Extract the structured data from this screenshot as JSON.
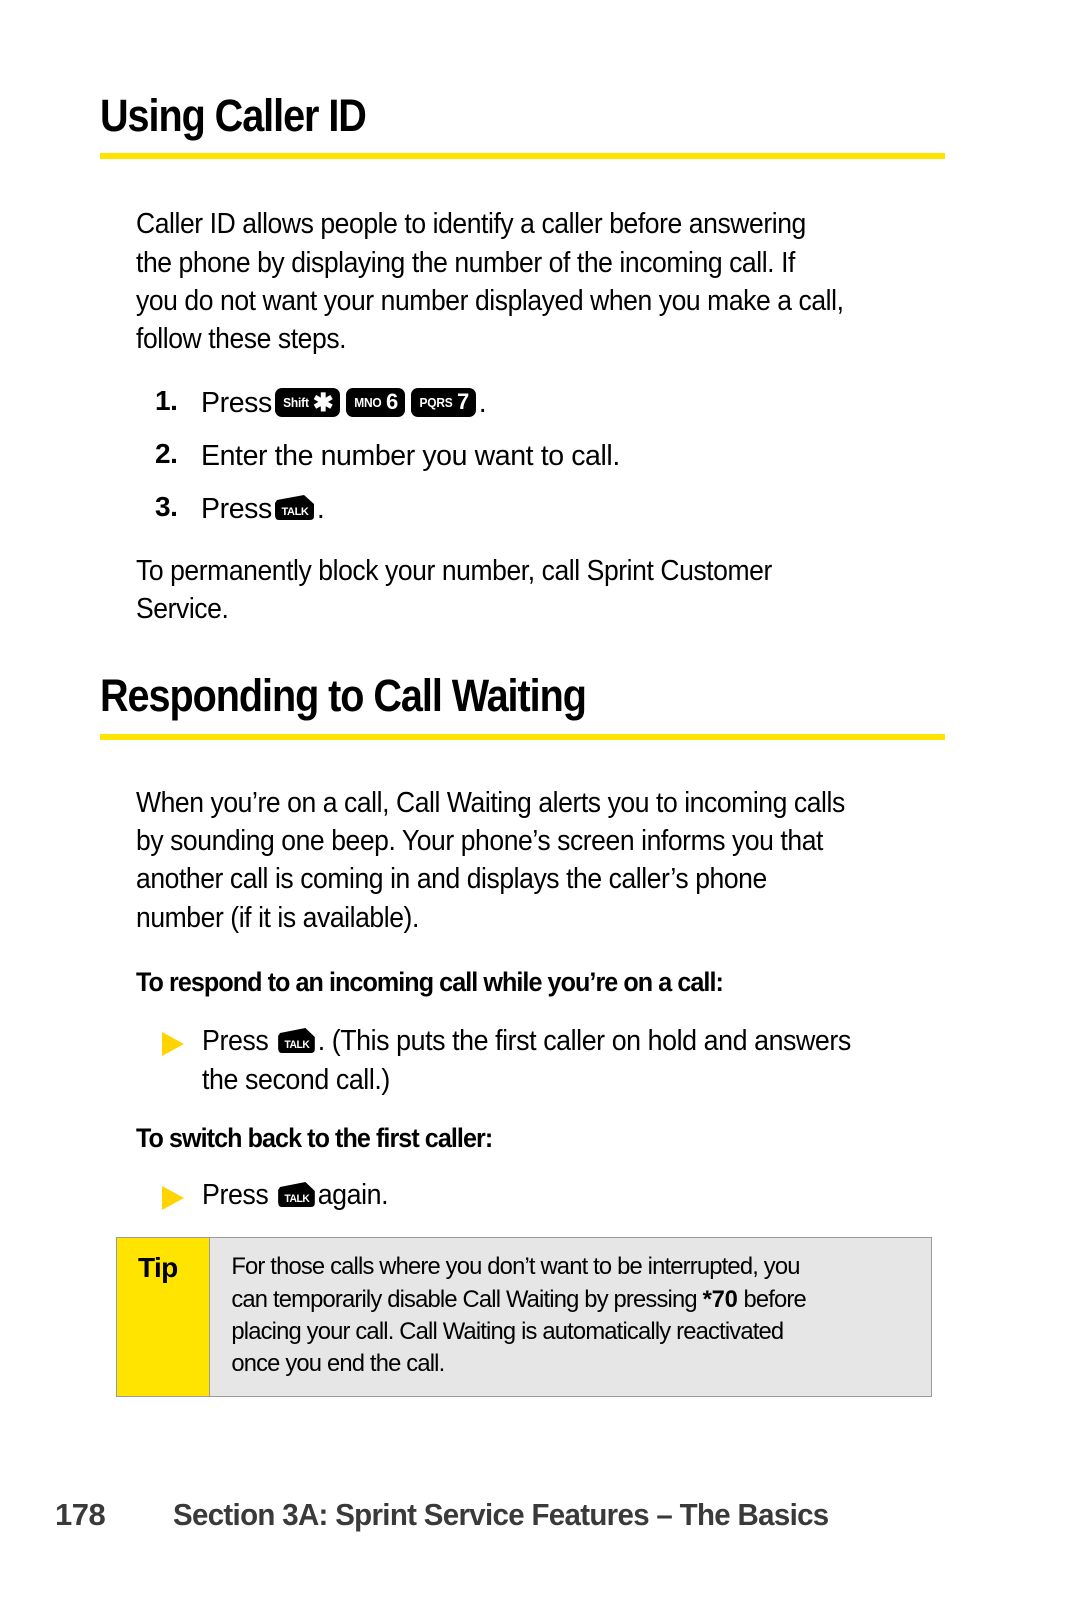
{
  "page": {
    "folio": "178",
    "footer_title": "Section 3A: Sprint Service Features – The Basics",
    "accent_yellow": "#FFE400",
    "tip_background": "#E6E6E6",
    "text_color": "#000000"
  },
  "section1": {
    "heading": "Using Caller ID",
    "intro_lines": [
      "Caller ID allows people to identify a caller before answering",
      "the phone by displaying the number of the incoming call. If",
      "you do not want your number displayed when you make a call,",
      "follow these steps."
    ],
    "steps": [
      {
        "number": "1.",
        "text_before": "Press",
        "keys": [
          {
            "label": "Shift",
            "glyph": "✱",
            "icon": "key-star-icon"
          },
          {
            "label": "MNO",
            "glyph": "6",
            "icon": "key-six-icon"
          },
          {
            "label": "PQRS",
            "glyph": "7",
            "icon": "key-seven-icon"
          }
        ],
        "text_after": "."
      },
      {
        "number": "2.",
        "text_before": "Enter the number you want to call.",
        "keys": [],
        "text_after": ""
      },
      {
        "number": "3.",
        "text_before": "Press",
        "keys": [
          {
            "label": "TALK",
            "glyph": "",
            "icon": "key-talk-icon"
          }
        ],
        "text_after": "."
      }
    ],
    "closing_lines": [
      "To permanently block your number, call Sprint Customer",
      "Service."
    ]
  },
  "section2": {
    "heading": "Responding to Call Waiting",
    "intro_lines": [
      "When you’re on a call, Call Waiting alerts you to incoming calls",
      "by sounding one beep. Your phone’s screen informs you that",
      "another call is coming in and displays the caller’s phone",
      "number (if it is available)."
    ],
    "subhead1": "To respond to an incoming call while you’re on a call:",
    "bullet1": {
      "text_before": "Press",
      "key": {
        "label": "TALK",
        "icon": "key-talk-icon"
      },
      "text_after_line1": ". (This puts the first caller on hold and answers",
      "text_after_line2": "the second call.)"
    },
    "subhead2": "To switch back to the first caller:",
    "bullet2": {
      "text_before": "Press",
      "key": {
        "label": "TALK",
        "icon": "key-talk-icon"
      },
      "text_after": "again."
    }
  },
  "tip": {
    "label": "Tip",
    "line1": "For those calls where you don’t want to be interrupted, you",
    "line2_a": "can temporarily disable Call Waiting by pressing ",
    "line2_code": "*70",
    "line2_b": " before",
    "line3": "placing your call. Call Waiting is automatically reactivated",
    "line4": "once you end the call."
  }
}
